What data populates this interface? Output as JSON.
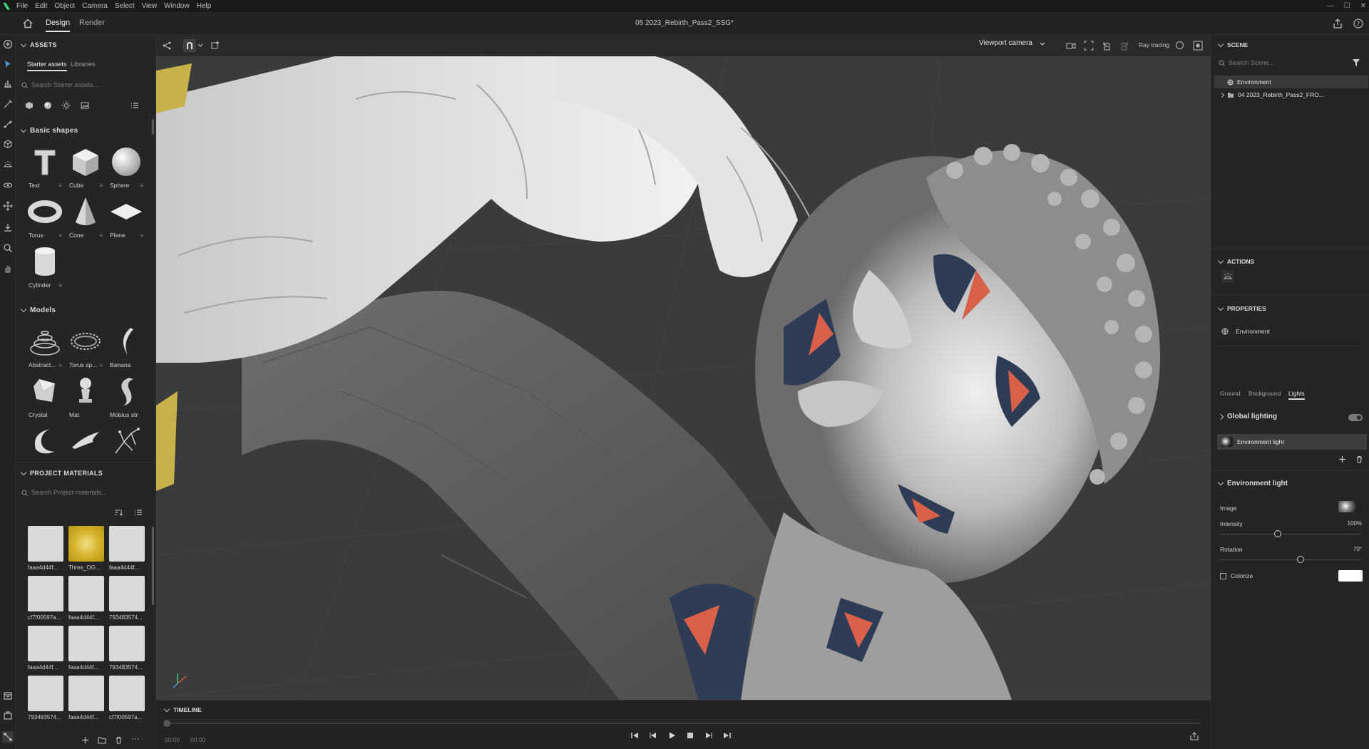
{
  "menubar": {
    "items": [
      "File",
      "Edit",
      "Object",
      "Camera",
      "Select",
      "View",
      "Window",
      "Help"
    ]
  },
  "header": {
    "tabs": [
      "Design",
      "Render"
    ],
    "active_tab": "Design",
    "document_title": "05 2023_Rebirth_Pass2_SSG*"
  },
  "assets": {
    "title": "ASSETS",
    "tabs": [
      "Starter assets",
      "Libraries"
    ],
    "search_placeholder": "Search Starter assets...",
    "basic_shapes": {
      "title": "Basic shapes",
      "items": [
        "Text",
        "Cube",
        "Sphere",
        "Torus",
        "Cone",
        "Plane",
        "Cylinder"
      ]
    },
    "models": {
      "title": "Models",
      "items": [
        "Abstract...",
        "Torus sp...",
        "Banana",
        "Crystal",
        "Mat",
        "Mobius strip"
      ]
    }
  },
  "project_materials": {
    "title": "PROJECT MATERIALS",
    "search_placeholder": "Search Project materials...",
    "items": [
      "faaa4d44f...",
      "Three_OG...",
      "faaa4d44f...",
      "cf7f00597a...",
      "faaa4d44f...",
      "793483574...",
      "faaa4d44f...",
      "faaa4d44f...",
      "793483574...",
      "793483574...",
      "faaa4d44f...",
      "cf7f00597a..."
    ]
  },
  "viewport": {
    "camera_label": "Viewport camera",
    "ray_tracing_label": "Ray tracing"
  },
  "timeline": {
    "title": "TIMELINE",
    "start_time": "00:00",
    "end_time": "00:00"
  },
  "scene": {
    "title": "SCENE",
    "search_placeholder": "Search Scene...",
    "tree": [
      "Environment",
      "04 2023_Rebirth_Pass2_FRO..."
    ]
  },
  "actions": {
    "title": "ACTIONS"
  },
  "properties": {
    "title": "PROPERTIES",
    "object_name": "Environment",
    "tabs": [
      "Ground",
      "Background",
      "Lights"
    ],
    "active_tab": "Lights",
    "global_lighting": "Global lighting",
    "env_light_row": "Environment light",
    "env_light_section": "Environment light",
    "image_label": "Image",
    "intensity_label": "Intensity",
    "intensity_value": "100%",
    "intensity_level": 0.41,
    "rotation_label": "Rotation",
    "rotation_value": "70°",
    "rotation_level": 0.57,
    "colorize_label": "Colorize"
  },
  "colors": {
    "background": "#1e1e1e",
    "panel": "#252525",
    "viewport": "#3b3b3b",
    "accent_green": "#3ddc84",
    "mesh": "#d8d8d8",
    "texture_red": "#d9614a",
    "texture_blue": "#2e3d55"
  }
}
